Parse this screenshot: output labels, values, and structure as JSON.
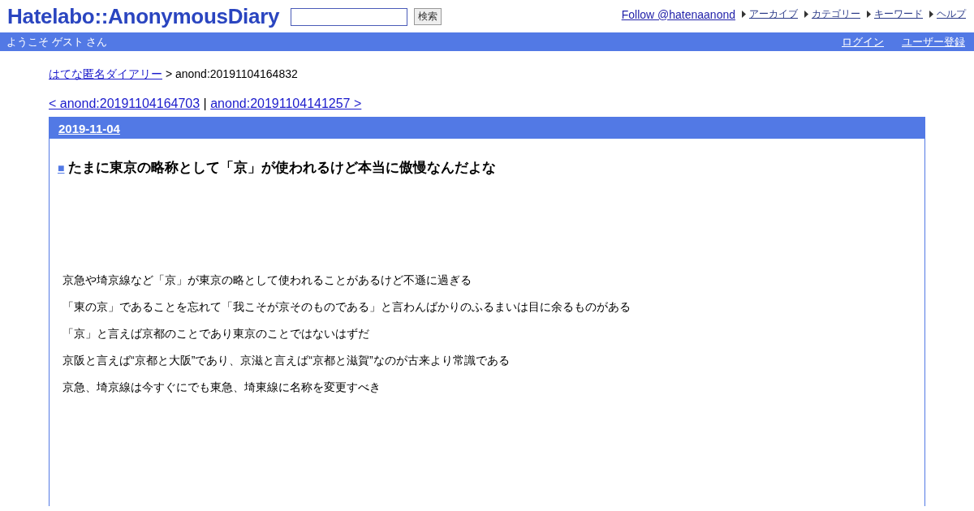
{
  "header": {
    "logo": "Hatelabo::AnonymousDiary",
    "search_button": "検索",
    "follow": "Follow @hatenaanond",
    "nav": [
      "アーカイブ",
      "カテゴリー",
      "キーワード",
      "ヘルプ"
    ]
  },
  "user_bar": {
    "welcome": "ようこそ ゲスト さん",
    "links": [
      "ログイン",
      "ユーザー登録"
    ]
  },
  "breadcrumb": {
    "link": "はてな匿名ダイアリー",
    "current": "> anond:20191104164832"
  },
  "pager": {
    "prev": "< anond:20191104164703",
    "separator": "|",
    "next": "anond:20191104141257 >"
  },
  "day": {
    "date": "2019-11-04",
    "title_mark": "■",
    "title": "たまに東京の略称として「京」が使われるけど本当に傲慢なんだよな",
    "paragraphs": [
      "京急や埼京線など「京」が東京の略として使われることがあるけど不遜に過ぎる",
      "「東の京」であることを忘れて「我こそが京そのものである」と言わんばかりのふるまいは目に余るものがある",
      "「京」と言えば京都のことであり東京のことではないはずだ",
      "京阪と言えば“京都と大阪”であり、京滋と言えば“京都と滋賀”なのが古来より常識である",
      "京急、埼京線は今すぐにでも東急、埼東線に名称を変更すべき"
    ]
  }
}
